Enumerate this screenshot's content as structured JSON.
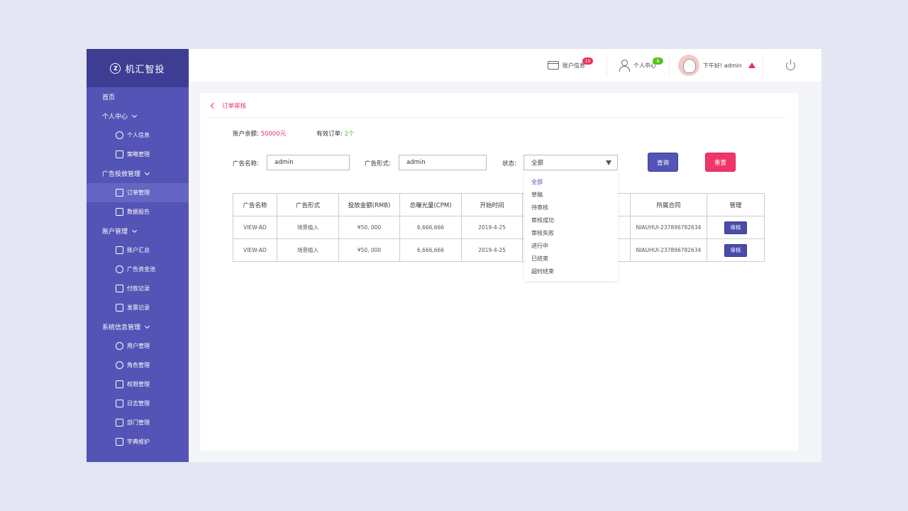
{
  "app": {
    "name": "机汇智投",
    "logo_mark": "Z"
  },
  "sidebar": {
    "sections": [
      {
        "label": "首页",
        "expandable": false,
        "items": []
      },
      {
        "label": "个人中心",
        "expandable": true,
        "items": [
          {
            "label": "个人信息",
            "icon": "user-icon"
          },
          {
            "label": "策略管理",
            "icon": "strategy-icon"
          }
        ]
      },
      {
        "label": "广告投放管理",
        "expandable": true,
        "items": [
          {
            "label": "订单管理",
            "icon": "order-icon",
            "active": true
          },
          {
            "label": "数据报告",
            "icon": "report-icon"
          }
        ]
      },
      {
        "label": "账户管理",
        "expandable": true,
        "items": [
          {
            "label": "账户汇总",
            "icon": "account-icon"
          },
          {
            "label": "广告资金池",
            "icon": "yen-icon"
          },
          {
            "label": "付款记录",
            "icon": "payment-icon"
          },
          {
            "label": "发票记录",
            "icon": "invoice-icon"
          }
        ]
      },
      {
        "label": "系统信息管理",
        "expandable": true,
        "items": [
          {
            "label": "用户管理",
            "icon": "users-icon"
          },
          {
            "label": "角色管理",
            "icon": "role-icon"
          },
          {
            "label": "权限管理",
            "icon": "permission-icon"
          },
          {
            "label": "日志管理",
            "icon": "log-icon"
          },
          {
            "label": "部门管理",
            "icon": "department-icon"
          },
          {
            "label": "字典维护",
            "icon": "dictionary-icon"
          }
        ]
      }
    ]
  },
  "header": {
    "account_info": {
      "label": "账户信息",
      "badge": "10",
      "badge_color": "#e8315e"
    },
    "personal_center": {
      "label": "个人中心",
      "badge": "8",
      "badge_color": "#52c41a"
    },
    "greeting": "下午好! admin"
  },
  "breadcrumb": {
    "label": "订单审核"
  },
  "summary": {
    "balance_label": "账户余额:",
    "balance_value": "50000元",
    "valid_orders_label": "有效订单:",
    "valid_orders_value": "2个"
  },
  "filters": {
    "ad_name_label": "广告名称:",
    "ad_name_value": "admin",
    "ad_form_label": "广告形式:",
    "ad_form_value": "admin",
    "status_label": "状态:",
    "status_value": "全部",
    "query_label": "查询",
    "reset_label": "重置"
  },
  "status_options": [
    "全部",
    "草稿",
    "待审核",
    "审核成功",
    "审核失败",
    "进行中",
    "已结束",
    "超时结束"
  ],
  "table": {
    "columns": [
      "广告名称",
      "广告形式",
      "投放金额(RMB)",
      "总曝光量(CPM)",
      "开始时间",
      "",
      "所属合同",
      "管理"
    ],
    "rows": [
      {
        "ad_name": "VIEW-AD",
        "ad_form": "场景植入",
        "amount": "¥50, 000",
        "impressions": "6,666,666",
        "start": "2019-4-25",
        "hidden": "",
        "contract": "NIAUHUI-237896782634",
        "action": "审核"
      },
      {
        "ad_name": "VIEW-AD",
        "ad_form": "场景植入",
        "amount": "¥50, 000",
        "impressions": "6,666,666",
        "start": "2019-4-25",
        "hidden": "",
        "contract": "NIAUHUI-237896782634",
        "action": "审核"
      }
    ]
  },
  "colors": {
    "sidebar": "#5454b6",
    "logo_bar": "#3c3d93",
    "accent": "#e8315e",
    "primary_button": "#5454b6",
    "danger_button": "#f0356b",
    "success": "#52c41a"
  }
}
